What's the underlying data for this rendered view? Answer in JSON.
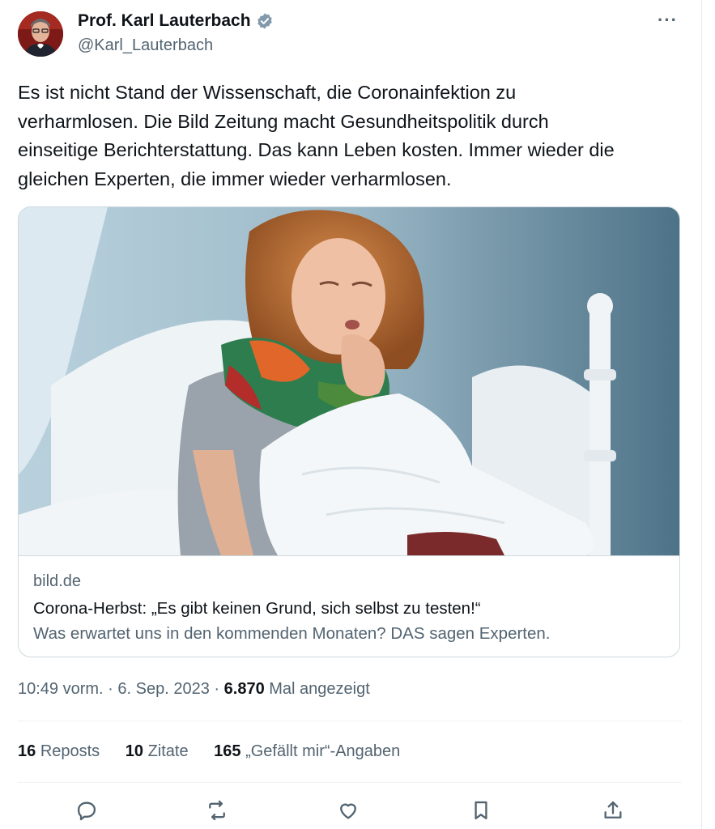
{
  "author": {
    "display_name": "Prof. Karl Lauterbach",
    "handle": "@Karl_Lauterbach",
    "verified": true
  },
  "tweet": {
    "text_lines": [
      "Es ist nicht Stand der Wissenschaft, die Coronainfektion zu",
      "verharmlosen. Die Bild Zeitung macht Gesundheitspolitik durch",
      "einseitige Berichterstattung. Das kann Leben kosten. Immer wieder die",
      "gleichen Experten, die immer wieder verharmlosen."
    ]
  },
  "card": {
    "domain": "bild.de",
    "title": "Corona-Herbst: „Es gibt keinen Grund, sich selbst zu testen!“",
    "description": "Was erwartet uns in den kommenden Monaten? DAS sagen Experten."
  },
  "meta": {
    "time": "10:49 vorm.",
    "separator": "·",
    "date": "6. Sep. 2023",
    "views_count": "6.870",
    "views_label": "Mal angezeigt"
  },
  "stats": [
    {
      "count": "16",
      "label": "Reposts"
    },
    {
      "count": "10",
      "label": "Zitate"
    },
    {
      "count": "165",
      "label": "„Gefällt mir“-Angaben"
    }
  ],
  "actions": [
    {
      "icon": "reply-icon"
    },
    {
      "icon": "repost-icon"
    },
    {
      "icon": "like-icon"
    },
    {
      "icon": "bookmark-icon"
    },
    {
      "icon": "share-icon"
    }
  ],
  "colors": {
    "text_primary": "#0f1419",
    "text_secondary": "#536471",
    "border": "#cfd9de",
    "verified_badge": "#829aab"
  }
}
